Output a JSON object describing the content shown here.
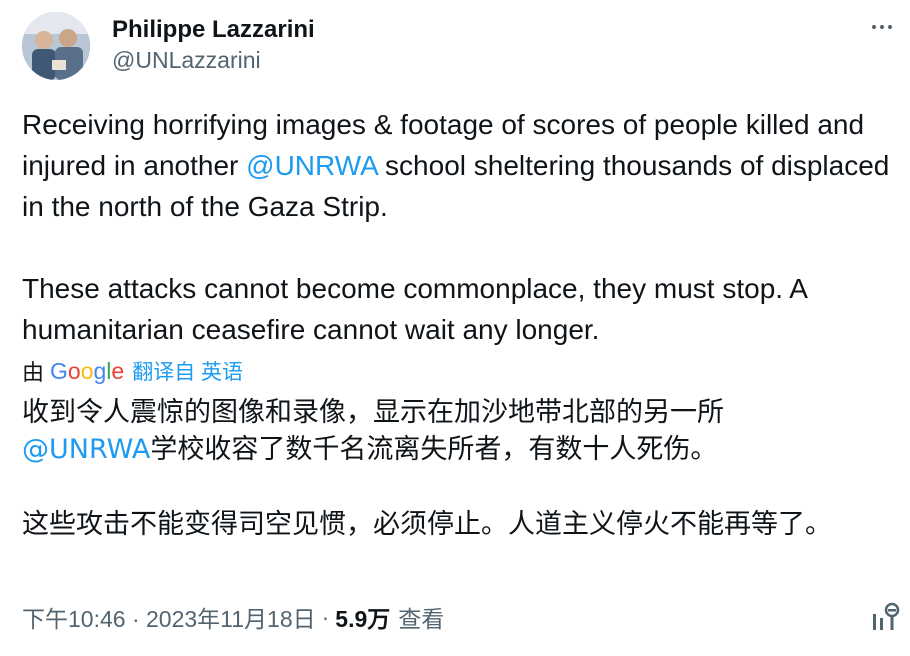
{
  "author": {
    "name": "Philippe Lazzarini",
    "handle": "@UNLazzarini"
  },
  "tweet": {
    "p1_before": "Receiving horrifying images & footage of scores of people killed and injured in another ",
    "p1_mention": "@UNRWA",
    "p1_after": " school sheltering thousands of displaced in the north of the Gaza Strip.",
    "p2": "These attacks cannot become commonplace, they must stop. A humanitarian ceasefire cannot wait any longer."
  },
  "translation": {
    "prefix": "由",
    "google_letters": [
      "G",
      "o",
      "o",
      "g",
      "l",
      "e"
    ],
    "link": "翻译自 英语",
    "p1_line1": "收到令人震惊的图像和录像，显示在加沙地带北部的另一所",
    "p1_mention": "@UNRWA",
    "p1_rest": "学校收容了数千名流离失所者，有数十人死伤。",
    "p2": "这些攻击不能变得司空见惯，必须停止。人道主义停火不能再等了。"
  },
  "meta": {
    "time": "下午10:46 · 2023年11月18日",
    "separator": "·",
    "views_count": "5.9万",
    "views_label": "查看"
  },
  "icons": {
    "more": "more-icon",
    "analytics": "analytics-icon"
  },
  "colors": {
    "text": "#0f1419",
    "secondary": "#536471",
    "link": "#1d9bf0"
  }
}
